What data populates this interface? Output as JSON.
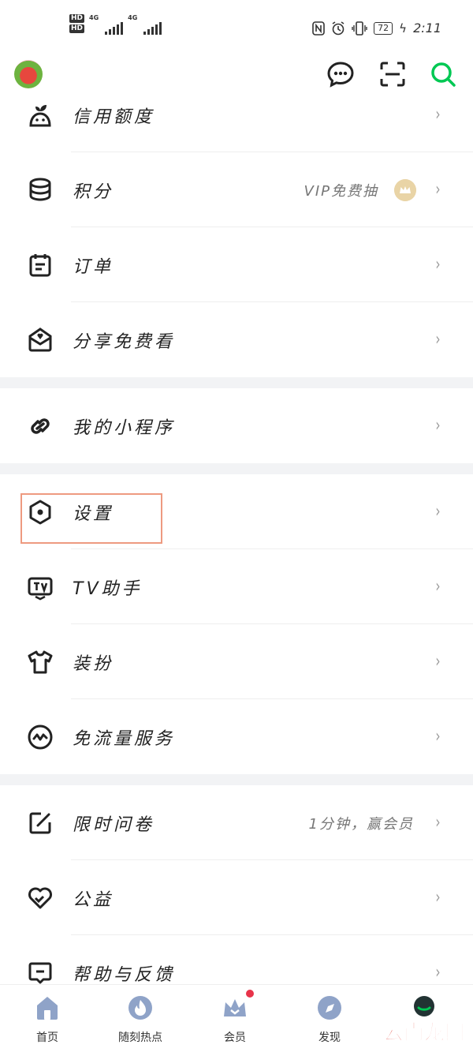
{
  "status": {
    "hd1": "HD",
    "hd2": "HD",
    "net1": "4G",
    "net2": "4G",
    "battery": "72",
    "time": "2:11"
  },
  "menu": [
    {
      "label": "信用额度",
      "icon": "sprout-icon",
      "extra": ""
    },
    {
      "label": "积分",
      "icon": "coins-icon",
      "extra": "VIP免费抽"
    },
    {
      "label": "订单",
      "icon": "order-icon",
      "extra": ""
    },
    {
      "label": "分享免费看",
      "icon": "share-envelope-icon",
      "extra": ""
    },
    {
      "label": "我的小程序",
      "icon": "link-icon",
      "extra": ""
    },
    {
      "label": "设置",
      "icon": "settings-hexagon-icon",
      "extra": ""
    },
    {
      "label": "TV助手",
      "icon": "tv-icon",
      "extra": ""
    },
    {
      "label": "装扮",
      "icon": "tshirt-icon",
      "extra": ""
    },
    {
      "label": "免流量服务",
      "icon": "pulse-icon",
      "extra": ""
    },
    {
      "label": "限时问卷",
      "icon": "edit-square-icon",
      "extra": "1分钟，赢会员"
    },
    {
      "label": "公益",
      "icon": "heart-icon",
      "extra": ""
    },
    {
      "label": "帮助与反馈",
      "icon": "message-icon",
      "extra": ""
    }
  ],
  "chevron": "›",
  "tabs": [
    {
      "label": "首页",
      "icon": "home-icon"
    },
    {
      "label": "随刻热点",
      "icon": "flame-icon"
    },
    {
      "label": "会员",
      "icon": "crown-icon"
    },
    {
      "label": "发现",
      "icon": "compass-icon"
    }
  ],
  "watermark": "云南龙网",
  "colors": {
    "accent": "#00c853",
    "highlight_border": "#ee9a80",
    "tab_icon": "#8fa3c8",
    "badge_dot": "#e8334a"
  }
}
